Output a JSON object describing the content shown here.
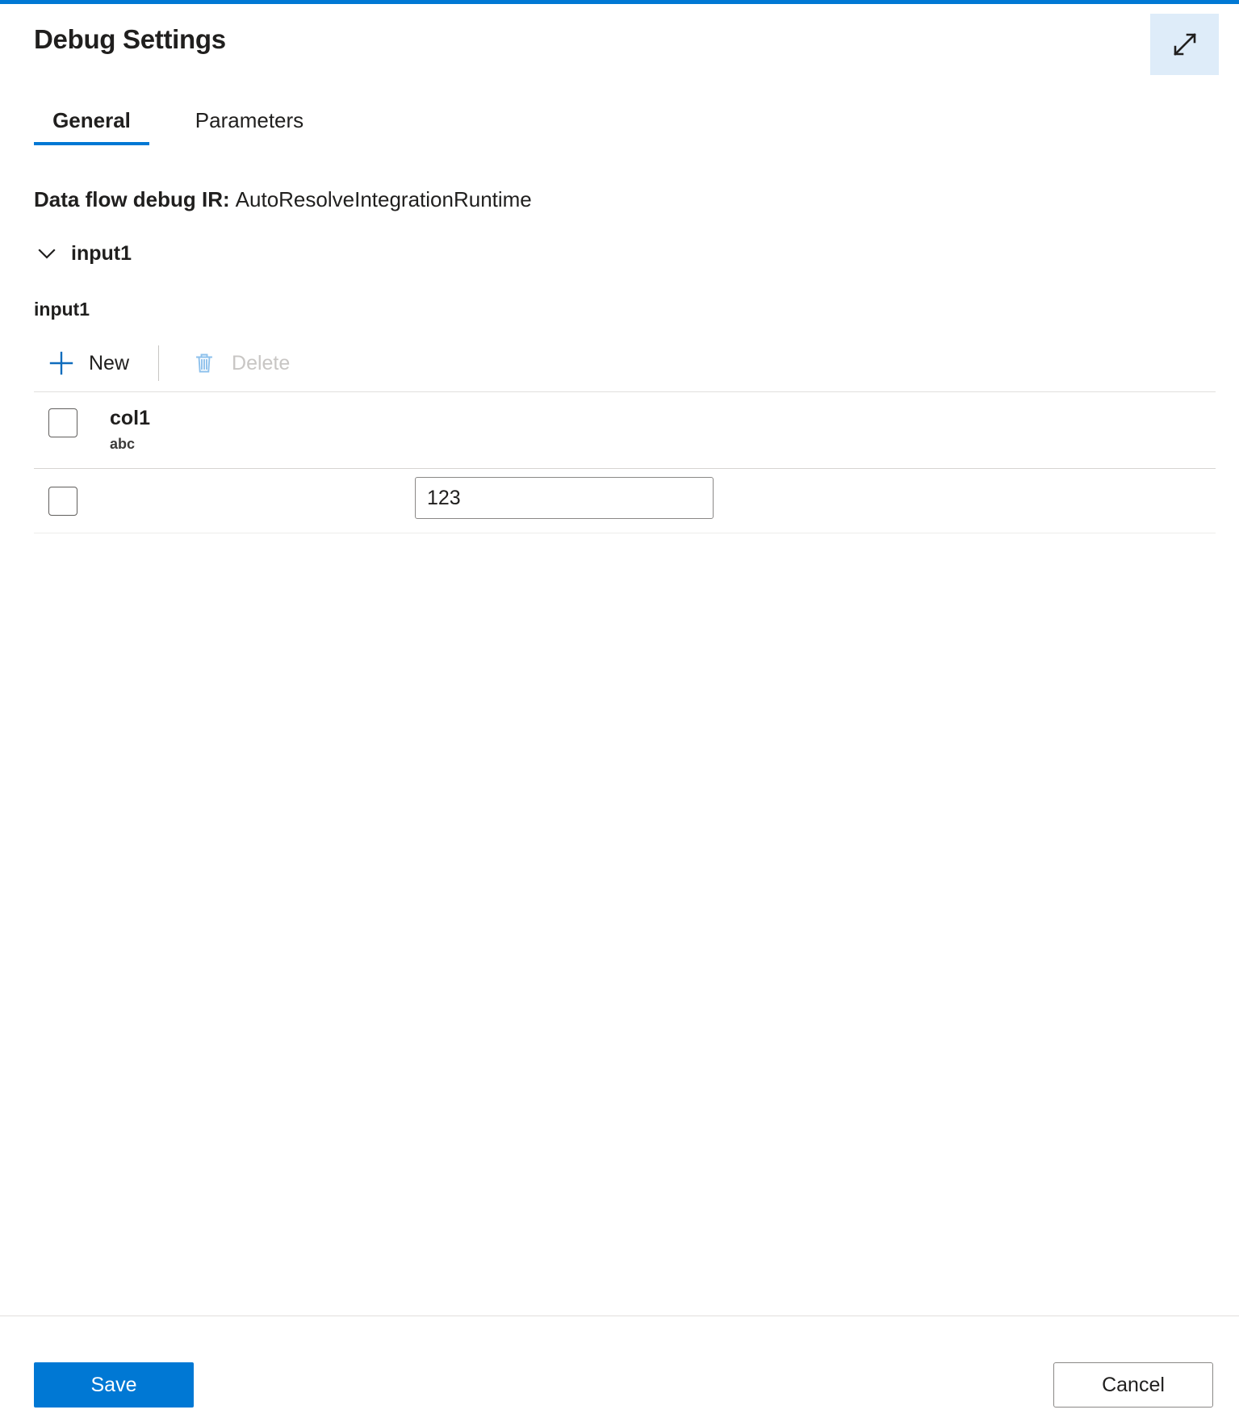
{
  "theme": {
    "accent": "#0078d4",
    "accent_light_bg": "#deecf9",
    "text": "#201f1e",
    "disabled_text": "#c8c6c4",
    "disabled_icon": "#8ec1ec",
    "border": "#8a8886",
    "row_border": "#e1dfdd"
  },
  "header": {
    "title": "Debug Settings",
    "expand_icon": "expand-diagonal-icon"
  },
  "tabs": [
    {
      "label": "General",
      "active": true
    },
    {
      "label": "Parameters",
      "active": false
    }
  ],
  "general": {
    "debug_ir_label": "Data flow debug IR:",
    "debug_ir_value": "AutoResolveIntegrationRuntime",
    "collapse": {
      "icon": "chevron-down-icon",
      "label": "input1",
      "expanded": true
    },
    "stream_name": "input1",
    "toolbar": {
      "new_label": "New",
      "new_icon": "plus-icon",
      "delete_label": "Delete",
      "delete_icon": "trash-icon",
      "delete_disabled": true
    },
    "table": {
      "columns": [
        {
          "name": "col1",
          "type": "abc"
        }
      ],
      "rows": [
        {
          "checked": false,
          "values": [
            "123"
          ]
        }
      ],
      "header_checked": false
    }
  },
  "footer": {
    "save_label": "Save",
    "cancel_label": "Cancel"
  }
}
